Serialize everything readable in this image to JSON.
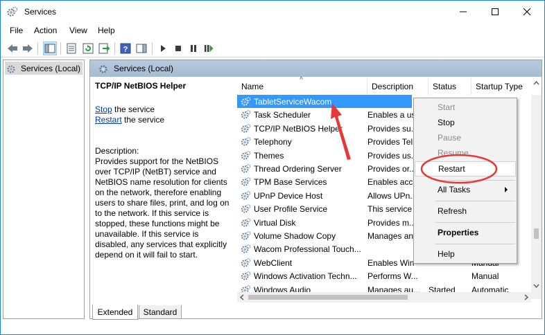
{
  "window": {
    "title": "Services",
    "minimize_icon": "minimize-icon",
    "maximize_icon": "maximize-icon",
    "close_icon": "close-icon"
  },
  "menubar": {
    "items": [
      "File",
      "Action",
      "View",
      "Help"
    ]
  },
  "toolbar": {
    "buttons": [
      "back-arrow-icon",
      "forward-arrow-icon",
      "show-hide-tree-icon",
      "properties-icon",
      "refresh-icon",
      "export-list-icon",
      "help-icon",
      "action-pane-icon",
      "play-icon",
      "stop-icon",
      "pause-icon",
      "restart-icon"
    ]
  },
  "tree": {
    "node_label": "Services (Local)"
  },
  "right_pane": {
    "header_title": "Services (Local)",
    "selected_service_title": "TCP/IP NetBIOS Helper",
    "stop_link": "Stop",
    "stop_suffix": " the service",
    "restart_link": "Restart",
    "restart_suffix": " the service",
    "description_label": "Description:",
    "description_text": "Provides support for the NetBIOS over TCP/IP (NetBT) service and NetBIOS name resolution for clients on the network, therefore enabling users to share files, print, and log on to the network. If this service is stopped, these functions might be unavailable. If this service is disabled, any services that explicitly depend on it will fail to start."
  },
  "list": {
    "columns": [
      "Name",
      "Description",
      "Status",
      "Startup Type"
    ],
    "rows": [
      {
        "name": "TabletServiceWacom",
        "description": "",
        "status": "",
        "startup": ""
      },
      {
        "name": "Task Scheduler",
        "description": "Enables a us",
        "status": "",
        "startup": ""
      },
      {
        "name": "TCP/IP NetBIOS Helper",
        "description": "Provides su...",
        "status": "",
        "startup": ""
      },
      {
        "name": "Telephony",
        "description": "Provides Tel",
        "status": "",
        "startup": ""
      },
      {
        "name": "Themes",
        "description": "Provides us...",
        "status": "",
        "startup": ""
      },
      {
        "name": "Thread Ordering Server",
        "description": "Provides or...",
        "status": "",
        "startup": ""
      },
      {
        "name": "TPM Base Services",
        "description": "Enables acc",
        "status": "",
        "startup": ""
      },
      {
        "name": "UPnP Device Host",
        "description": "Allows UPn...",
        "status": "",
        "startup": ""
      },
      {
        "name": "User Profile Service",
        "description": "This service",
        "status": "",
        "startup": ""
      },
      {
        "name": "Virtual Disk",
        "description": "Provides m...",
        "status": "",
        "startup": ""
      },
      {
        "name": "Volume Shadow Copy",
        "description": "Manages an",
        "status": "",
        "startup": ""
      },
      {
        "name": "Wacom Professional Touch...",
        "description": "",
        "status": "",
        "startup": ""
      },
      {
        "name": "WebClient",
        "description": "Enables Win",
        "status": "",
        "startup": "Manual"
      },
      {
        "name": "Windows Activation Techn...",
        "description": "Performs W...",
        "status": "",
        "startup": "Manual"
      },
      {
        "name": "Windows Audio",
        "description": "Manages au...",
        "status": "Started",
        "startup": "Automatic"
      }
    ]
  },
  "tabs": [
    "Extended",
    "Standard"
  ],
  "context_menu": {
    "items": [
      {
        "label": "Start",
        "state": "disabled"
      },
      {
        "label": "Stop",
        "state": "enabled"
      },
      {
        "label": "Pause",
        "state": "disabled"
      },
      {
        "label": "Resume",
        "state": "disabled"
      },
      {
        "label": "Restart",
        "state": "hover"
      },
      {
        "label": "All Tasks",
        "state": "submenu"
      },
      {
        "label": "Refresh",
        "state": "enabled"
      },
      {
        "label": "Properties",
        "state": "bold"
      },
      {
        "label": "Help",
        "state": "enabled"
      }
    ]
  },
  "colors": {
    "selection": "#3399ff",
    "link": "#0033cc",
    "annotation_red": "#e53935",
    "header_gradient": "#a5bcd4"
  }
}
